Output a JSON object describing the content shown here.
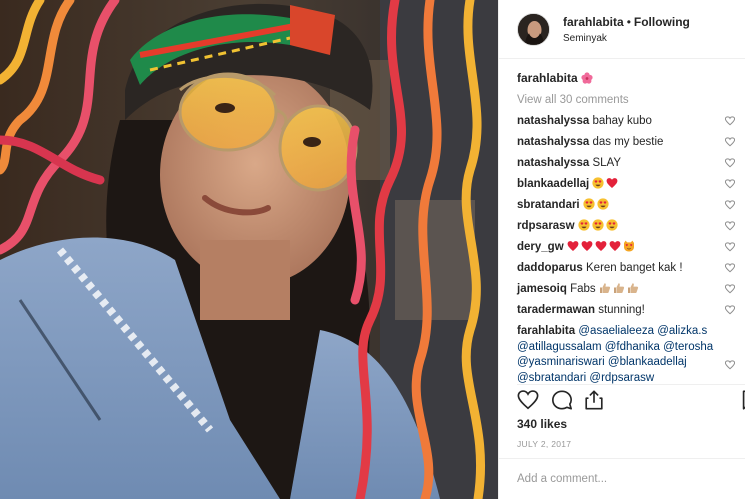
{
  "post": {
    "username": "farahlabita",
    "separator": "•",
    "follow_status": "Following",
    "location": "Seminyak",
    "caption_username": "farahlabita",
    "caption_emoji": "hibiscus-emoji",
    "view_all": "View all 30 comments",
    "likes": "340 likes",
    "date": "JULY 2, 2017",
    "add_comment_placeholder": "Add a comment..."
  },
  "comments": [
    {
      "user": "natashalyssa",
      "text": "bahay kubo"
    },
    {
      "user": "natashalyssa",
      "text": "das my bestie"
    },
    {
      "user": "natashalyssa",
      "text": "SLAY"
    },
    {
      "user": "blankaadellaj",
      "text": "",
      "emojis": [
        "heart-eyes-emoji",
        "red-heart-emoji"
      ]
    },
    {
      "user": "sbratandari",
      "text": "",
      "emojis": [
        "heart-eyes-emoji",
        "heart-eyes-emoji"
      ]
    },
    {
      "user": "rdpsarasw",
      "text": "",
      "emojis": [
        "heart-eyes-emoji",
        "heart-eyes-emoji",
        "heart-eyes-emoji"
      ]
    },
    {
      "user": "dery_gw",
      "text": "",
      "emojis": [
        "red-heart-emoji",
        "red-heart-emoji",
        "red-heart-emoji",
        "red-heart-emoji",
        "heart-eyes-cat-emoji"
      ]
    },
    {
      "user": "daddoparus",
      "text": "Keren banget kak !"
    },
    {
      "user": "jamesoiq",
      "text": "Fabs",
      "emojis": [
        "thumbs-up-emoji",
        "thumbs-up-emoji",
        "thumbs-up-emoji"
      ]
    },
    {
      "user": "taradermawan",
      "text": "stunning!"
    }
  ],
  "mention_block": {
    "user": "farahlabita",
    "mentions": [
      "@asaelialeeza",
      "@alizka.s",
      "@atillagussalam",
      "@fdhanika",
      "@terosha",
      "@yasminariswari",
      "@blankaadellaj",
      "@sbratandari",
      "@rdpsarasw"
    ]
  },
  "icons": {
    "like": "heart-outline-icon",
    "comment": "comment-bubble-icon",
    "share": "share-icon",
    "save": "bookmark-icon"
  },
  "colors": {
    "text": "#262626",
    "muted": "#999999",
    "mention": "#003569",
    "border": "#efefef"
  }
}
